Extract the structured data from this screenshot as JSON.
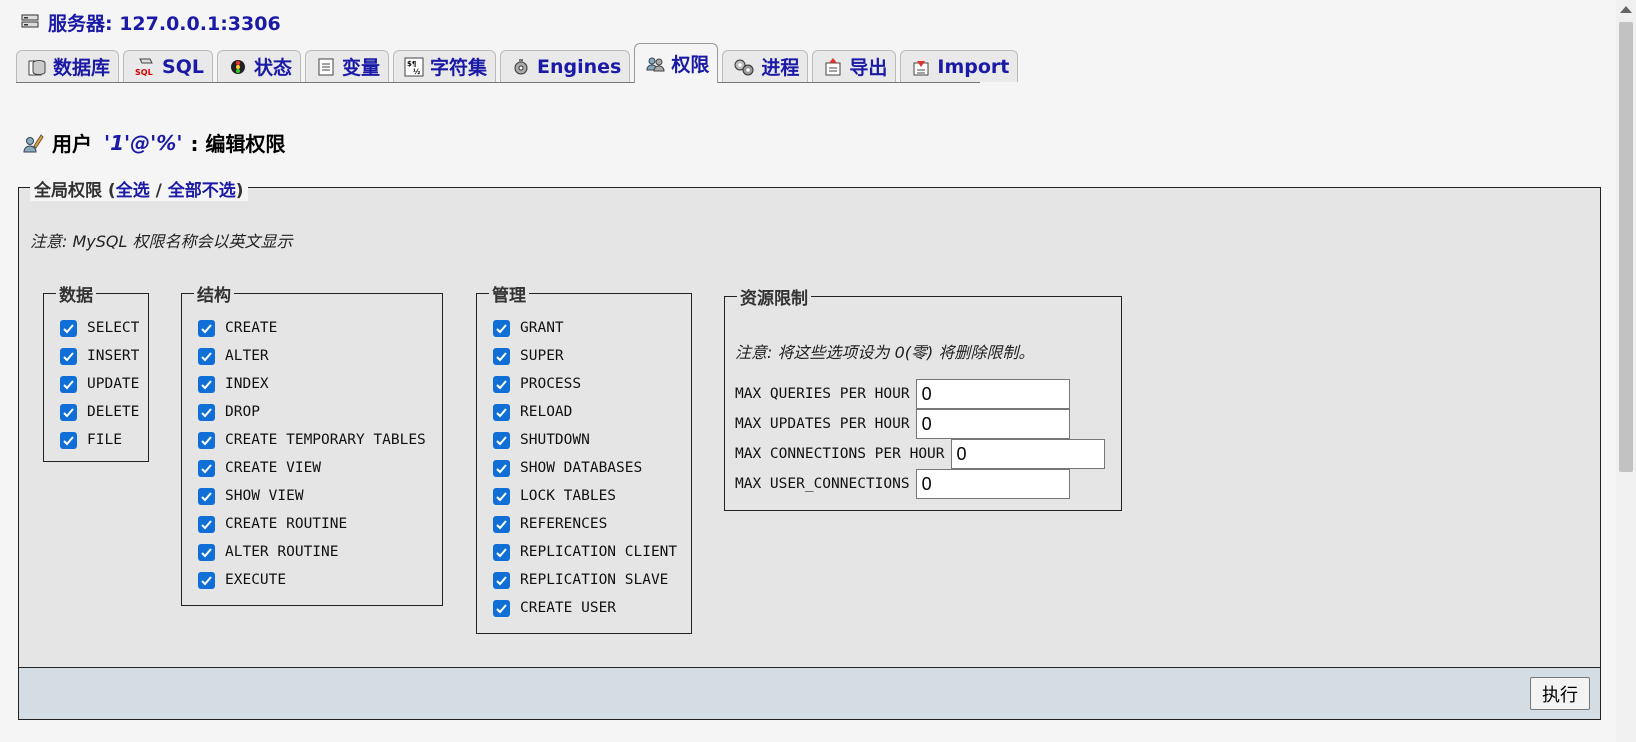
{
  "server": {
    "icon": "server-icon",
    "label": "服务器: 127.0.0.1:3306"
  },
  "tabs": [
    {
      "label": "数据库",
      "icon": "database-icon",
      "active": false
    },
    {
      "label": "SQL",
      "icon": "sql-icon",
      "active": false
    },
    {
      "label": "状态",
      "icon": "status-icon",
      "active": false
    },
    {
      "label": "变量",
      "icon": "variables-icon",
      "active": false
    },
    {
      "label": "字符集",
      "icon": "charset-icon",
      "active": false
    },
    {
      "label": "Engines",
      "icon": "engines-icon",
      "active": false
    },
    {
      "label": "权限",
      "icon": "privileges-icon",
      "active": true
    },
    {
      "label": "进程",
      "icon": "processes-icon",
      "active": false
    },
    {
      "label": "导出",
      "icon": "export-icon",
      "active": false
    },
    {
      "label": "Import",
      "icon": "import-icon",
      "active": false
    }
  ],
  "title": {
    "prefix": "用户",
    "user": "'1'@'%'",
    "suffix": ": 编辑权限",
    "icon": "edit-user-icon"
  },
  "global": {
    "legend_text": "全局权限 (",
    "check_all": "全选",
    "separator": " / ",
    "uncheck_all": "全部不选",
    "close_paren": ")",
    "note": "注意: MySQL 权限名称会以英文显示"
  },
  "groups": {
    "data": {
      "legend": "数据",
      "items": [
        {
          "label": "SELECT",
          "checked": true
        },
        {
          "label": "INSERT",
          "checked": true
        },
        {
          "label": "UPDATE",
          "checked": true
        },
        {
          "label": "DELETE",
          "checked": true
        },
        {
          "label": "FILE",
          "checked": true
        }
      ]
    },
    "structure": {
      "legend": "结构",
      "items": [
        {
          "label": "CREATE",
          "checked": true
        },
        {
          "label": "ALTER",
          "checked": true
        },
        {
          "label": "INDEX",
          "checked": true
        },
        {
          "label": "DROP",
          "checked": true
        },
        {
          "label": "CREATE TEMPORARY TABLES",
          "checked": true
        },
        {
          "label": "CREATE VIEW",
          "checked": true
        },
        {
          "label": "SHOW VIEW",
          "checked": true
        },
        {
          "label": "CREATE ROUTINE",
          "checked": true
        },
        {
          "label": "ALTER ROUTINE",
          "checked": true
        },
        {
          "label": "EXECUTE",
          "checked": true
        }
      ]
    },
    "admin": {
      "legend": "管理",
      "items": [
        {
          "label": "GRANT",
          "checked": true
        },
        {
          "label": "SUPER",
          "checked": true
        },
        {
          "label": "PROCESS",
          "checked": true
        },
        {
          "label": "RELOAD",
          "checked": true
        },
        {
          "label": "SHUTDOWN",
          "checked": true
        },
        {
          "label": "SHOW DATABASES",
          "checked": true
        },
        {
          "label": "LOCK TABLES",
          "checked": true
        },
        {
          "label": "REFERENCES",
          "checked": true
        },
        {
          "label": "REPLICATION CLIENT",
          "checked": true
        },
        {
          "label": "REPLICATION SLAVE",
          "checked": true
        },
        {
          "label": "CREATE USER",
          "checked": true
        }
      ]
    }
  },
  "resources": {
    "legend": "资源限制",
    "note": "注意: 将这些选项设为 0(零) 将删除限制。",
    "items": [
      {
        "label": "MAX QUERIES PER HOUR",
        "value": "0"
      },
      {
        "label": "MAX UPDATES PER HOUR",
        "value": "0"
      },
      {
        "label": "MAX CONNECTIONS PER HOUR",
        "value": "0"
      },
      {
        "label": "MAX USER_CONNECTIONS",
        "value": "0"
      }
    ]
  },
  "go_button": "执行",
  "colors": {
    "link": "#1a1aa6",
    "checkbox": "#0f6fd6",
    "footer": "#d4dce4",
    "panel": "#e5e5e5"
  }
}
